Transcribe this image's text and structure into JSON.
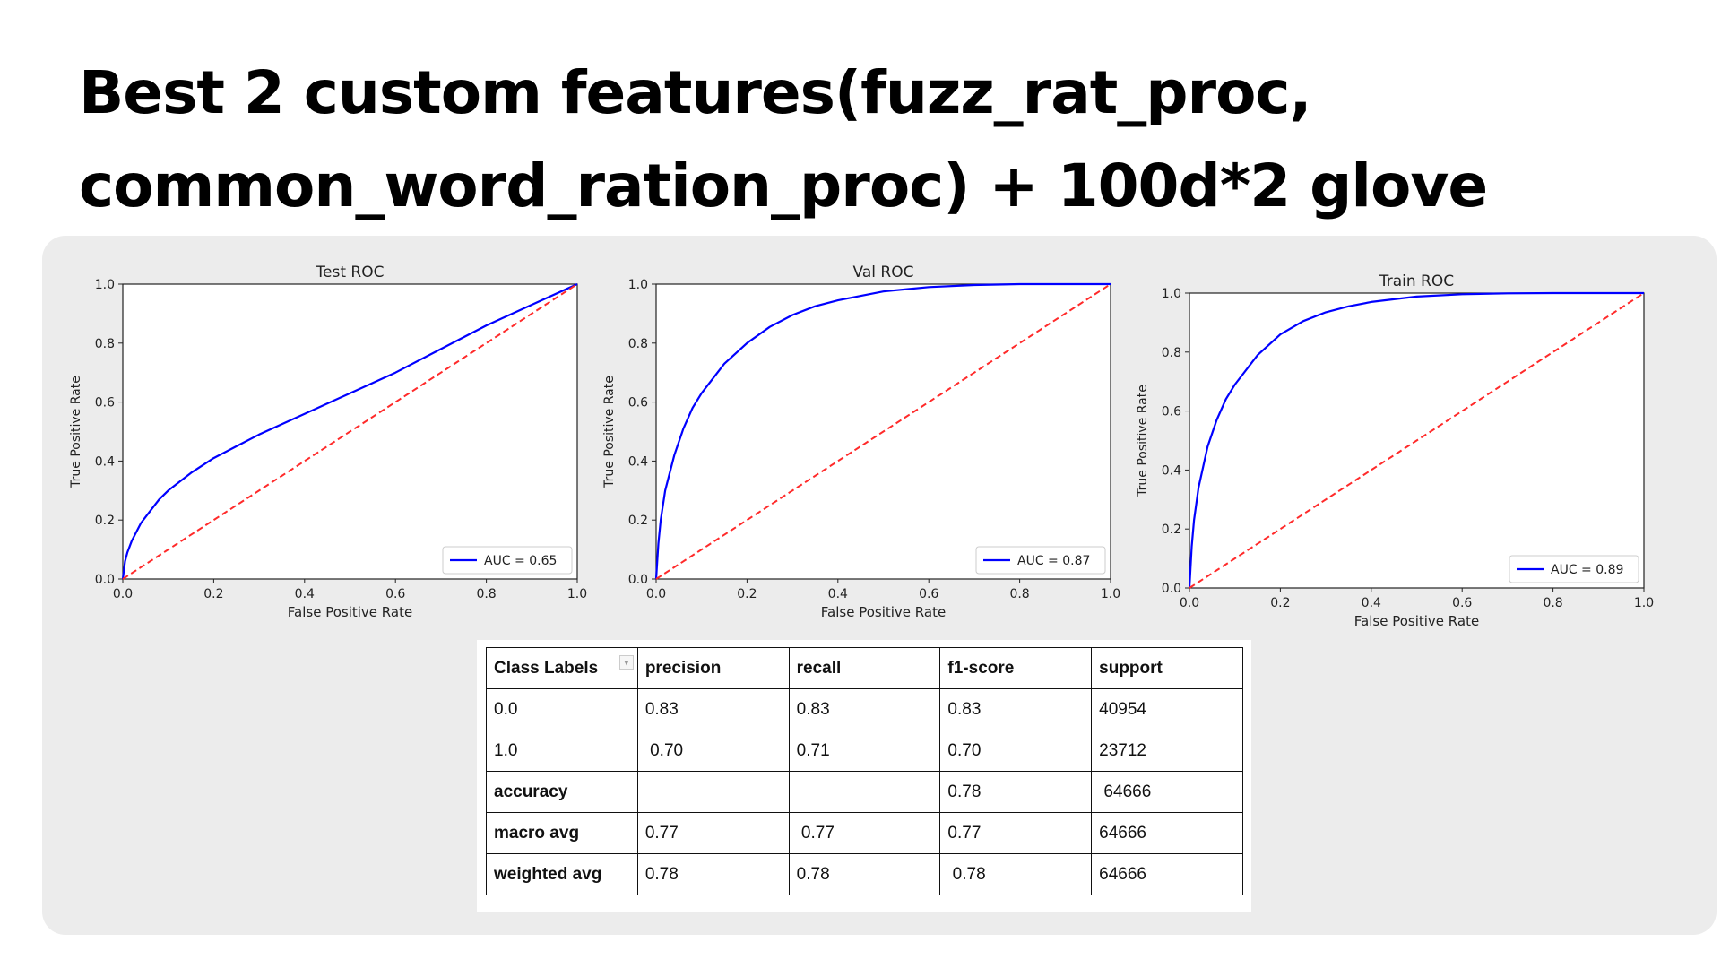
{
  "slide": {
    "title_line1": "Best 2 custom features(fuzz_rat_proc,",
    "title_line2": "common_word_ration_proc) + 100d*2 glove"
  },
  "colors": {
    "roc": "#0000ff",
    "diag": "#ff2a2a",
    "panel": "#ececec"
  },
  "chart_data": [
    {
      "type": "line",
      "title": "Test ROC",
      "xlabel": "False Positive Rate",
      "ylabel": "True Positive Rate",
      "xlim": [
        0,
        1
      ],
      "ylim": [
        0,
        1
      ],
      "xticks": [
        "0.0",
        "0.2",
        "0.4",
        "0.6",
        "0.8",
        "1.0"
      ],
      "yticks": [
        "0.0",
        "0.2",
        "0.4",
        "0.6",
        "0.8",
        "1.0"
      ],
      "legend": "AUC = 0.65",
      "legend_position": "lower-right",
      "grid": false,
      "series": [
        {
          "name": "AUC = 0.65",
          "x": [
            0,
            0.005,
            0.01,
            0.02,
            0.04,
            0.06,
            0.08,
            0.1,
            0.15,
            0.2,
            0.25,
            0.3,
            0.4,
            0.5,
            0.6,
            0.7,
            0.8,
            0.9,
            1.0
          ],
          "y": [
            0,
            0.06,
            0.09,
            0.13,
            0.19,
            0.23,
            0.27,
            0.3,
            0.36,
            0.41,
            0.45,
            0.49,
            0.56,
            0.63,
            0.7,
            0.78,
            0.86,
            0.93,
            1.0
          ]
        },
        {
          "name": "",
          "x": [
            0,
            1
          ],
          "y": [
            0,
            1
          ]
        }
      ]
    },
    {
      "type": "line",
      "title": "Val ROC",
      "xlabel": "False Positive Rate",
      "ylabel": "True Positive Rate",
      "xlim": [
        0,
        1
      ],
      "ylim": [
        0,
        1
      ],
      "xticks": [
        "0.0",
        "0.2",
        "0.4",
        "0.6",
        "0.8",
        "1.0"
      ],
      "yticks": [
        "0.0",
        "0.2",
        "0.4",
        "0.6",
        "0.8",
        "1.0"
      ],
      "legend": "AUC = 0.87",
      "legend_position": "lower-right",
      "grid": false,
      "series": [
        {
          "name": "AUC = 0.87",
          "x": [
            0,
            0.005,
            0.01,
            0.02,
            0.04,
            0.06,
            0.08,
            0.1,
            0.15,
            0.2,
            0.25,
            0.3,
            0.35,
            0.4,
            0.5,
            0.6,
            0.7,
            0.8,
            0.9,
            1.0
          ],
          "y": [
            0,
            0.12,
            0.2,
            0.3,
            0.42,
            0.51,
            0.58,
            0.63,
            0.73,
            0.8,
            0.855,
            0.895,
            0.925,
            0.945,
            0.975,
            0.99,
            0.997,
            1.0,
            1.0,
            1.0
          ]
        },
        {
          "name": "",
          "x": [
            0,
            1
          ],
          "y": [
            0,
            1
          ]
        }
      ]
    },
    {
      "type": "line",
      "title": "Train ROC",
      "xlabel": "False Positive Rate",
      "ylabel": "True Positive Rate",
      "xlim": [
        0,
        1
      ],
      "ylim": [
        0,
        1
      ],
      "xticks": [
        "0.0",
        "0.2",
        "0.4",
        "0.6",
        "0.8",
        "1.0"
      ],
      "yticks": [
        "0.0",
        "0.2",
        "0.4",
        "0.6",
        "0.8",
        "1.0"
      ],
      "legend": "AUC = 0.89",
      "legend_position": "lower-right",
      "grid": false,
      "series": [
        {
          "name": "AUC = 0.89",
          "x": [
            0,
            0.005,
            0.01,
            0.02,
            0.04,
            0.06,
            0.08,
            0.1,
            0.15,
            0.2,
            0.25,
            0.3,
            0.35,
            0.4,
            0.5,
            0.6,
            0.7,
            0.8,
            0.9,
            1.0
          ],
          "y": [
            0,
            0.14,
            0.23,
            0.34,
            0.48,
            0.57,
            0.64,
            0.69,
            0.79,
            0.86,
            0.905,
            0.935,
            0.955,
            0.97,
            0.988,
            0.996,
            0.999,
            1.0,
            1.0,
            1.0
          ]
        },
        {
          "name": "",
          "x": [
            0,
            1
          ],
          "y": [
            0,
            1
          ]
        }
      ]
    }
  ],
  "report_table": {
    "headers": [
      "Class Labels",
      "precision",
      "recall",
      "f1-score",
      "support"
    ],
    "rows": [
      [
        "0.0",
        "0.83",
        "0.83",
        "0.83",
        "40954"
      ],
      [
        "1.0",
        " 0.70",
        "0.71",
        "0.70",
        "23712"
      ],
      [
        "accuracy",
        "",
        "",
        "0.78",
        " 64666"
      ],
      [
        "macro avg",
        "0.77",
        " 0.77",
        "0.77",
        "64666"
      ],
      [
        "weighted avg",
        "0.78",
        "0.78",
        " 0.78",
        "64666"
      ]
    ]
  }
}
